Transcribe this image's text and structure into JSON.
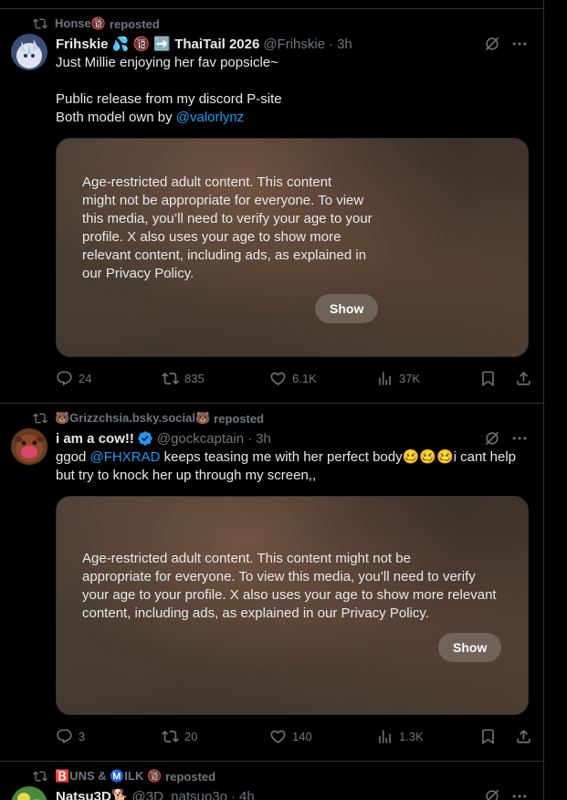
{
  "posts": [
    {
      "reposted_by": "Honse🔞",
      "reposted_suffix": "reposted",
      "name": "Frihskie 💦 🔞 ➡️ ThaiTail 2026",
      "handle": "@Frihskie",
      "time": "3h",
      "text_lines": [
        "Just Millie enjoying her fav popsicle~",
        "",
        "Public release from my discord P-site"
      ],
      "text_prefix": "Both model own by ",
      "text_link": "@valorlynz",
      "media_warning_lines": [
        "Age-restricted adult content. This content",
        "might not be appropriate for everyone. To view",
        "this media, you’ll need to verify your age to your",
        "profile. X also uses your age to show more",
        "relevant content, including ads, as explained in",
        "our Privacy Policy."
      ],
      "show_label": "Show",
      "replies": "24",
      "reposts": "835",
      "likes": "6.1K",
      "views": "37K"
    },
    {
      "reposted_by": "🐻Grizzchsia.bsky.social🐻",
      "reposted_suffix": "reposted",
      "name": "i am a cow!!",
      "handle": "@gockcaptain",
      "time": "3h",
      "text_prefix": "ggod ",
      "text_link": "@FHXRAD",
      "text_suffix": " keeps teasing me with her perfect body🥴🥴🥴i cant help",
      "text_line2": "but try to knock her up through my screen,,",
      "media_warning_lines": [
        "Age-restricted adult content. This content might not be",
        "appropriate for everyone. To view this media, you’ll need to verify",
        "your age to your profile. X also uses your age to show more relevant",
        "content, including ads, as explained in our Privacy Policy."
      ],
      "show_label": "Show",
      "replies": "3",
      "reposts": "20",
      "likes": "140",
      "views": "1.3K"
    },
    {
      "reposted_by": "🅱️UNS & Ⓜ️ILK 🔞",
      "reposted_suffix": "reposted",
      "name": "Natsu3D🐕",
      "handle": "@3D_natsuo3o",
      "time": "4h"
    }
  ],
  "colors": {
    "background": "#000000",
    "text": "#e7e9ea",
    "muted": "#71767b",
    "link": "#1d9bf0",
    "border": "#2f3336",
    "verified": "#1d9bf0"
  }
}
